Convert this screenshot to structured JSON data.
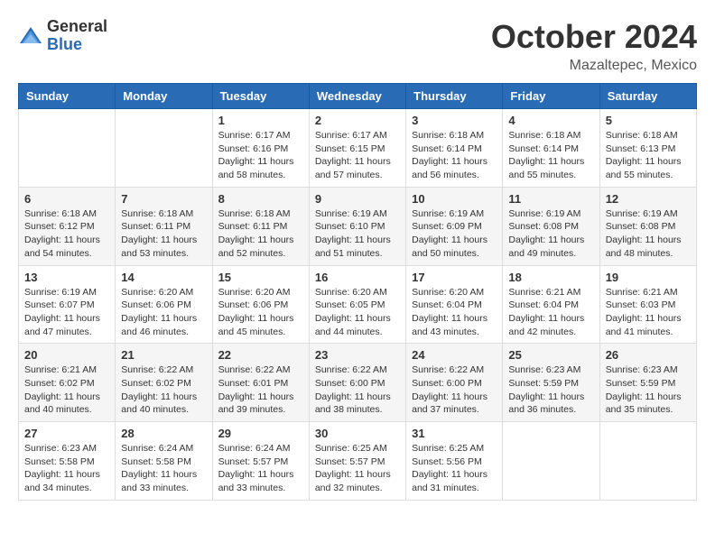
{
  "header": {
    "logo_general": "General",
    "logo_blue": "Blue",
    "month_title": "October 2024",
    "location": "Mazaltepec, Mexico"
  },
  "days_of_week": [
    "Sunday",
    "Monday",
    "Tuesday",
    "Wednesday",
    "Thursday",
    "Friday",
    "Saturday"
  ],
  "weeks": [
    [
      {
        "day": "",
        "detail": ""
      },
      {
        "day": "",
        "detail": ""
      },
      {
        "day": "1",
        "detail": "Sunrise: 6:17 AM\nSunset: 6:16 PM\nDaylight: 11 hours and 58 minutes."
      },
      {
        "day": "2",
        "detail": "Sunrise: 6:17 AM\nSunset: 6:15 PM\nDaylight: 11 hours and 57 minutes."
      },
      {
        "day": "3",
        "detail": "Sunrise: 6:18 AM\nSunset: 6:14 PM\nDaylight: 11 hours and 56 minutes."
      },
      {
        "day": "4",
        "detail": "Sunrise: 6:18 AM\nSunset: 6:14 PM\nDaylight: 11 hours and 55 minutes."
      },
      {
        "day": "5",
        "detail": "Sunrise: 6:18 AM\nSunset: 6:13 PM\nDaylight: 11 hours and 55 minutes."
      }
    ],
    [
      {
        "day": "6",
        "detail": "Sunrise: 6:18 AM\nSunset: 6:12 PM\nDaylight: 11 hours and 54 minutes."
      },
      {
        "day": "7",
        "detail": "Sunrise: 6:18 AM\nSunset: 6:11 PM\nDaylight: 11 hours and 53 minutes."
      },
      {
        "day": "8",
        "detail": "Sunrise: 6:18 AM\nSunset: 6:11 PM\nDaylight: 11 hours and 52 minutes."
      },
      {
        "day": "9",
        "detail": "Sunrise: 6:19 AM\nSunset: 6:10 PM\nDaylight: 11 hours and 51 minutes."
      },
      {
        "day": "10",
        "detail": "Sunrise: 6:19 AM\nSunset: 6:09 PM\nDaylight: 11 hours and 50 minutes."
      },
      {
        "day": "11",
        "detail": "Sunrise: 6:19 AM\nSunset: 6:08 PM\nDaylight: 11 hours and 49 minutes."
      },
      {
        "day": "12",
        "detail": "Sunrise: 6:19 AM\nSunset: 6:08 PM\nDaylight: 11 hours and 48 minutes."
      }
    ],
    [
      {
        "day": "13",
        "detail": "Sunrise: 6:19 AM\nSunset: 6:07 PM\nDaylight: 11 hours and 47 minutes."
      },
      {
        "day": "14",
        "detail": "Sunrise: 6:20 AM\nSunset: 6:06 PM\nDaylight: 11 hours and 46 minutes."
      },
      {
        "day": "15",
        "detail": "Sunrise: 6:20 AM\nSunset: 6:06 PM\nDaylight: 11 hours and 45 minutes."
      },
      {
        "day": "16",
        "detail": "Sunrise: 6:20 AM\nSunset: 6:05 PM\nDaylight: 11 hours and 44 minutes."
      },
      {
        "day": "17",
        "detail": "Sunrise: 6:20 AM\nSunset: 6:04 PM\nDaylight: 11 hours and 43 minutes."
      },
      {
        "day": "18",
        "detail": "Sunrise: 6:21 AM\nSunset: 6:04 PM\nDaylight: 11 hours and 42 minutes."
      },
      {
        "day": "19",
        "detail": "Sunrise: 6:21 AM\nSunset: 6:03 PM\nDaylight: 11 hours and 41 minutes."
      }
    ],
    [
      {
        "day": "20",
        "detail": "Sunrise: 6:21 AM\nSunset: 6:02 PM\nDaylight: 11 hours and 40 minutes."
      },
      {
        "day": "21",
        "detail": "Sunrise: 6:22 AM\nSunset: 6:02 PM\nDaylight: 11 hours and 40 minutes."
      },
      {
        "day": "22",
        "detail": "Sunrise: 6:22 AM\nSunset: 6:01 PM\nDaylight: 11 hours and 39 minutes."
      },
      {
        "day": "23",
        "detail": "Sunrise: 6:22 AM\nSunset: 6:00 PM\nDaylight: 11 hours and 38 minutes."
      },
      {
        "day": "24",
        "detail": "Sunrise: 6:22 AM\nSunset: 6:00 PM\nDaylight: 11 hours and 37 minutes."
      },
      {
        "day": "25",
        "detail": "Sunrise: 6:23 AM\nSunset: 5:59 PM\nDaylight: 11 hours and 36 minutes."
      },
      {
        "day": "26",
        "detail": "Sunrise: 6:23 AM\nSunset: 5:59 PM\nDaylight: 11 hours and 35 minutes."
      }
    ],
    [
      {
        "day": "27",
        "detail": "Sunrise: 6:23 AM\nSunset: 5:58 PM\nDaylight: 11 hours and 34 minutes."
      },
      {
        "day": "28",
        "detail": "Sunrise: 6:24 AM\nSunset: 5:58 PM\nDaylight: 11 hours and 33 minutes."
      },
      {
        "day": "29",
        "detail": "Sunrise: 6:24 AM\nSunset: 5:57 PM\nDaylight: 11 hours and 33 minutes."
      },
      {
        "day": "30",
        "detail": "Sunrise: 6:25 AM\nSunset: 5:57 PM\nDaylight: 11 hours and 32 minutes."
      },
      {
        "day": "31",
        "detail": "Sunrise: 6:25 AM\nSunset: 5:56 PM\nDaylight: 11 hours and 31 minutes."
      },
      {
        "day": "",
        "detail": ""
      },
      {
        "day": "",
        "detail": ""
      }
    ]
  ]
}
